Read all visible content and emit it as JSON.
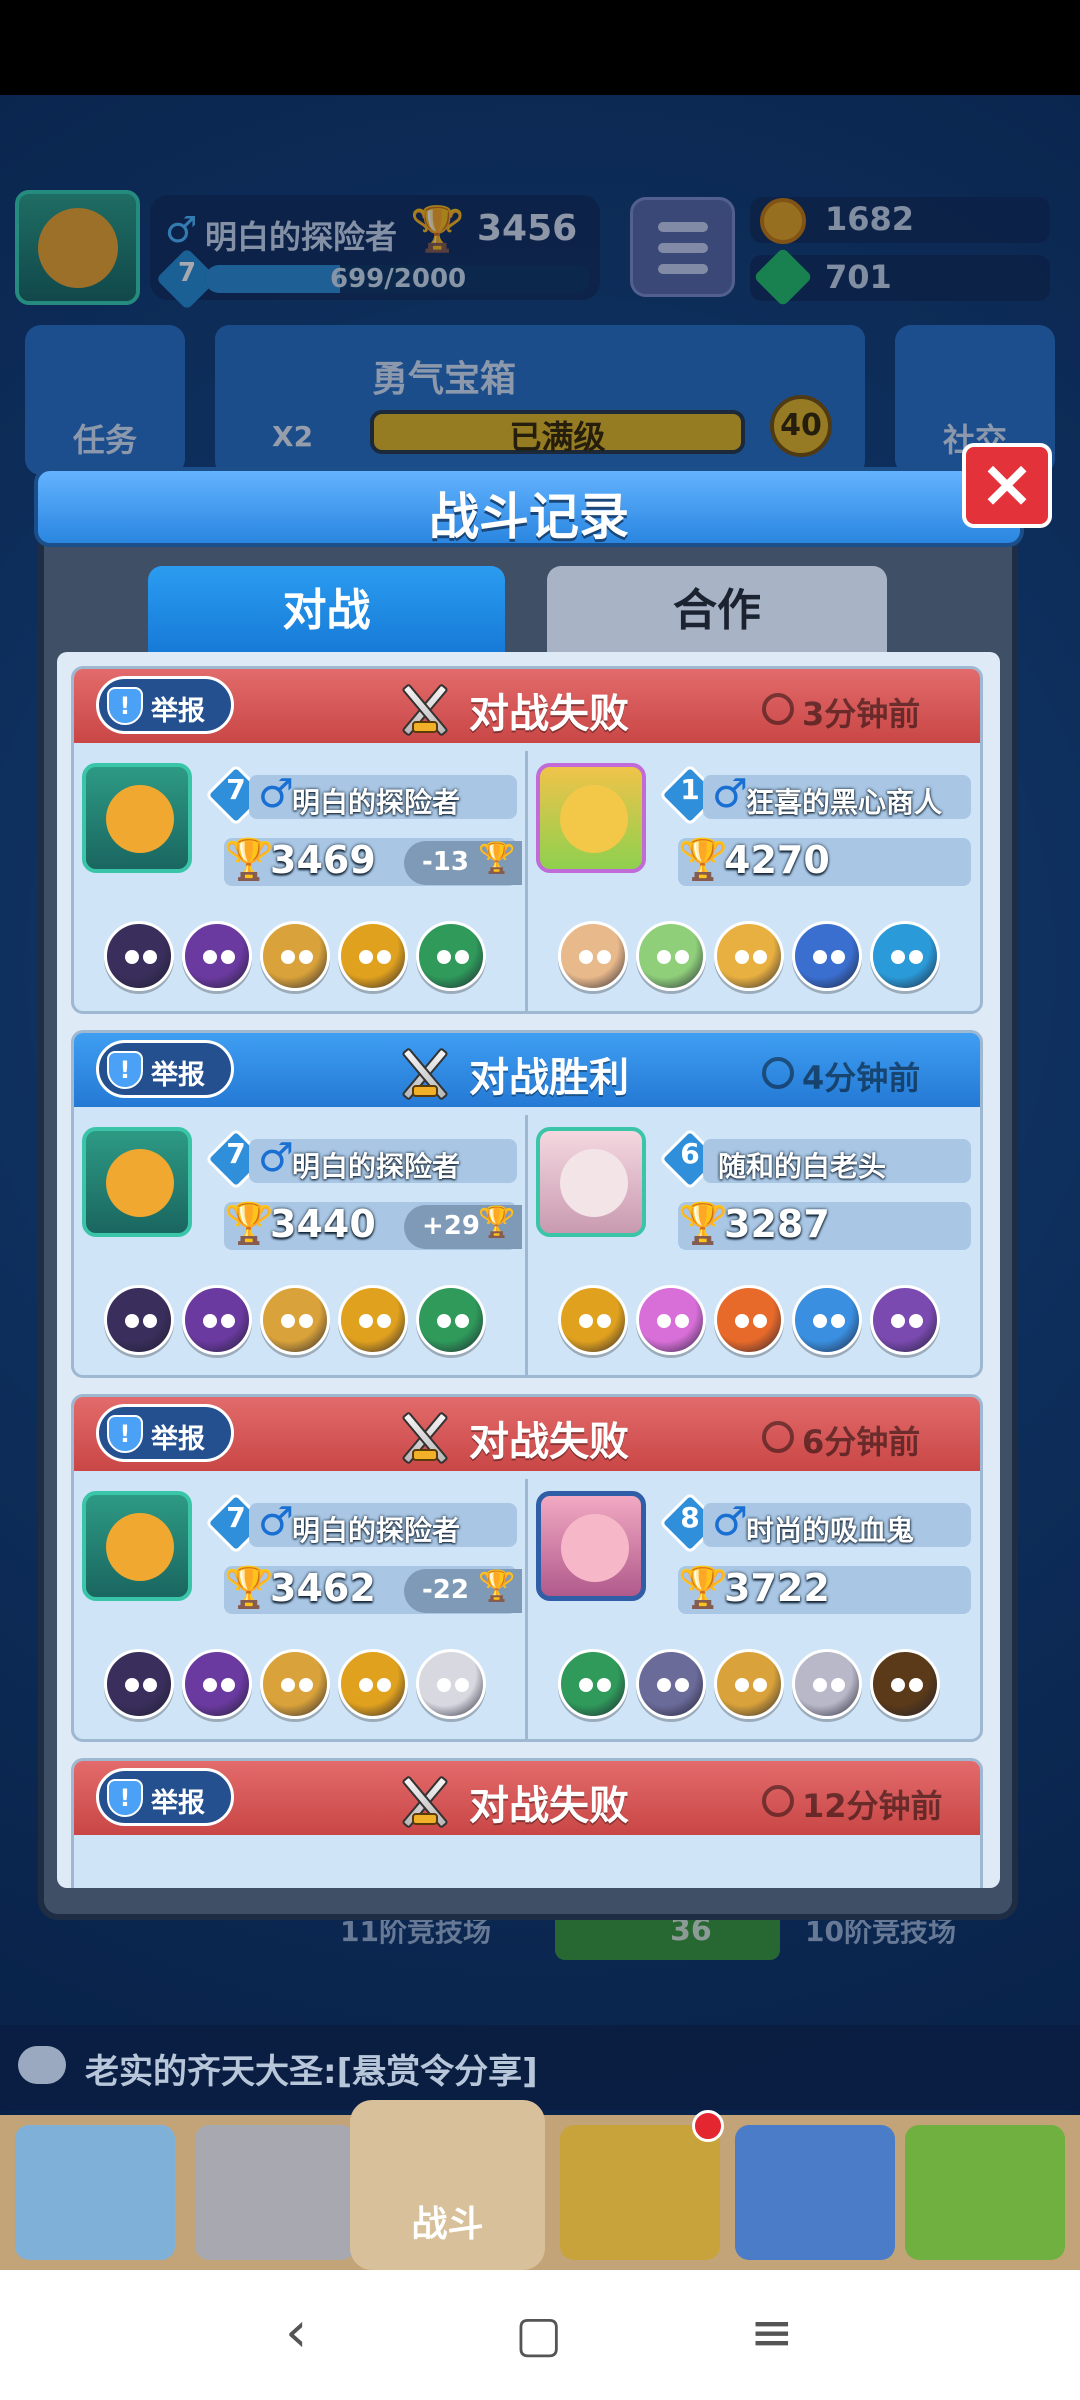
{
  "hud": {
    "player_name": "明白的探险者",
    "trophies": "3456",
    "level": "7",
    "xp_text": "699/2000",
    "xp_fraction": 0.35,
    "coins": "1682",
    "gems": "701",
    "tasks_label": "任务",
    "chest_title": "勇气宝箱",
    "chest_multiplier": "X2",
    "chest_status": "已满级",
    "chest_count": "40",
    "community_label": "社交"
  },
  "modal": {
    "title": "战斗记录",
    "close_label": "×",
    "tabs": [
      {
        "label": "对战",
        "active": true
      },
      {
        "label": "合作",
        "active": false
      }
    ],
    "report_label": "举报",
    "battles": [
      {
        "result": "对战失败",
        "outcome": "lose",
        "time": "3分钟前",
        "me": {
          "level": "7",
          "name": "明白的探险者",
          "trophies": "3469",
          "delta": "-13",
          "heroes": [
            "#3a2f5c",
            "#6b3aa0",
            "#d9a23a",
            "#e0a11e",
            "#2f9a5a"
          ]
        },
        "opponent": {
          "level": "1",
          "name": "狂喜的黑心商人",
          "trophies": "4270",
          "gender": true,
          "avatar": "sticker",
          "heroes": [
            "#e8b98a",
            "#8fcf7a",
            "#e8b040",
            "#3a6fd0",
            "#2b9ad8"
          ]
        }
      },
      {
        "result": "对战胜利",
        "outcome": "win",
        "time": "4分钟前",
        "me": {
          "level": "7",
          "name": "明白的探险者",
          "trophies": "3440",
          "delta": "+29",
          "heroes": [
            "#3a2f5c",
            "#6b3aa0",
            "#d9a23a",
            "#e0a11e",
            "#2f9a5a"
          ]
        },
        "opponent": {
          "level": "6",
          "name": "随和的白老头",
          "trophies": "3287",
          "gender": false,
          "avatar": "pink",
          "heroes": [
            "#e0a11e",
            "#d86fd8",
            "#e86a2a",
            "#3a8fe0",
            "#7a4ab0"
          ]
        }
      },
      {
        "result": "对战失败",
        "outcome": "lose",
        "time": "6分钟前",
        "me": {
          "level": "7",
          "name": "明白的探险者",
          "trophies": "3462",
          "delta": "-22",
          "heroes": [
            "#3a2f5c",
            "#6b3aa0",
            "#d9a23a",
            "#e0a11e",
            "#d8d8e0"
          ]
        },
        "opponent": {
          "level": "8",
          "name": "时尚的吸血鬼",
          "trophies": "3722",
          "gender": true,
          "avatar": "purple",
          "heroes": [
            "#2f9a5a",
            "#6b6b9a",
            "#d9a23a",
            "#b8b8c8",
            "#5a3a18"
          ]
        }
      },
      {
        "result": "对战失败",
        "outcome": "lose",
        "time": "12分钟前"
      }
    ]
  },
  "background": {
    "arena_left": "11阶竞技场",
    "arena_gem_count": "36",
    "arena_right": "10阶竞技场",
    "chat_message": "老实的齐天大圣:[悬赏令分享]",
    "nav_battle_label": "战斗"
  },
  "colors": {
    "lose_header": "#d35454",
    "win_header": "#2f8ae0",
    "accent": "#2b9cf0"
  }
}
